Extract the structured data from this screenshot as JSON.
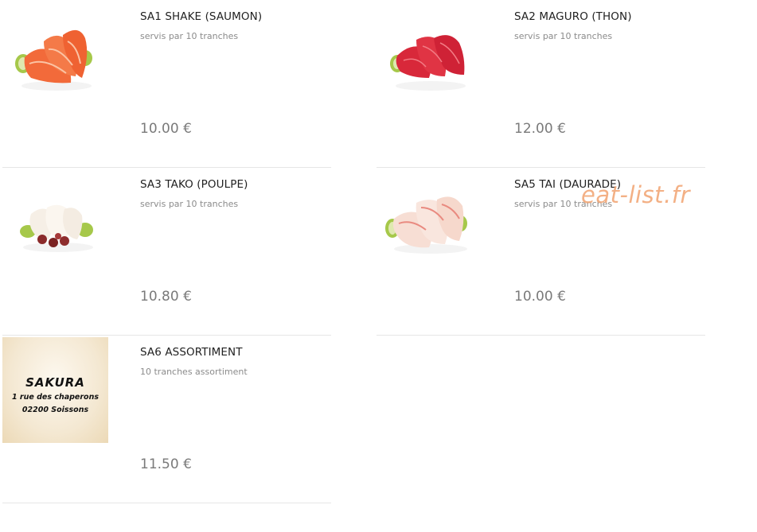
{
  "menu": {
    "items": [
      {
        "title": "SA1 SHAKE (SAUMON)",
        "description": "servis par 10 tranches",
        "price": "10.00 €",
        "image": "salmon-sashimi-image"
      },
      {
        "title": "SA2 MAGURO (THON)",
        "description": "servis par 10 tranches",
        "price": "12.00 €",
        "image": "tuna-sashimi-image"
      },
      {
        "title": "SA3 TAKO (POULPE)",
        "description": "servis par 10 tranches",
        "price": "10.80 €",
        "image": "octopus-sashimi-image"
      },
      {
        "title": "SA5 TAI (DAURADE)",
        "description": "servis par 10 tranches",
        "price": "10.00 €",
        "image": "sea-bream-sashimi-image"
      },
      {
        "title": "SA6 ASSORTIMENT",
        "description": "10 tranches assortiment",
        "price": "11.50 €",
        "image": "restaurant-logo-card"
      }
    ]
  },
  "logo_card": {
    "brand": "SAKURA",
    "address_line1": "1 rue des chaperons",
    "address_line2": "02200  Soissons"
  },
  "watermark": "eat-list.fr",
  "colors": {
    "salmon": "#f26a3a",
    "tuna": "#d8283a",
    "cucumber": "#a6c84a",
    "watermark": "#f2a878",
    "divider": "#e6e6e6"
  }
}
